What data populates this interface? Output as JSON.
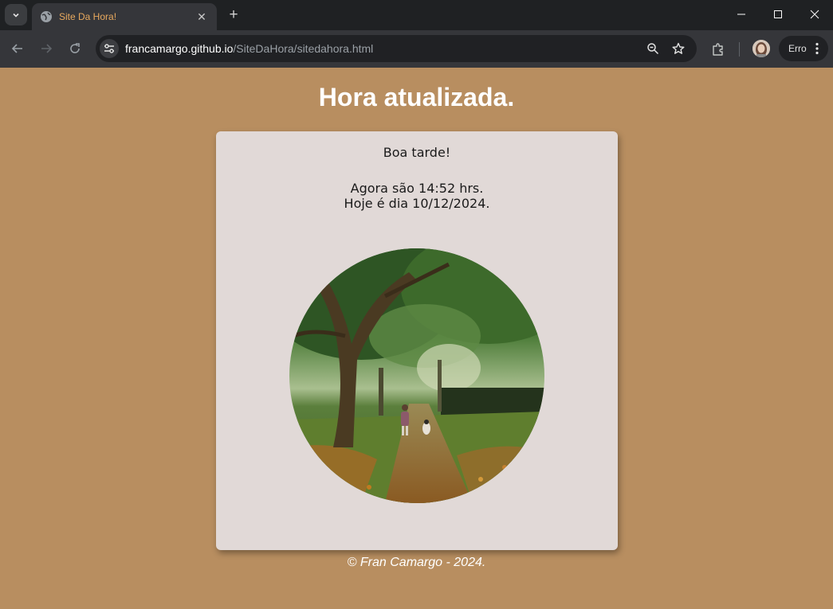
{
  "browser": {
    "tab_title": "Site Da Hora!",
    "url_host": "francamargo.github.io",
    "url_path": "/SiteDaHora/sitedahora.html",
    "profile_label": "Erro"
  },
  "page": {
    "title": "Hora atualizada.",
    "greeting": "Boa tarde!",
    "time_text": "Agora são 14:52 hrs.",
    "date_text": "Hoje é dia 10/12/2024.",
    "footer": "© Fran Camargo - 2024."
  },
  "colors": {
    "page_background": "#b88e60",
    "card_background": "#e1d9d7",
    "tab_title": "#e8a95e"
  },
  "icons": [
    "tab-search-icon",
    "globe-icon",
    "close-icon",
    "plus-icon",
    "minimize-icon",
    "maximize-icon",
    "window-close-icon",
    "back-icon",
    "forward-icon",
    "reload-icon",
    "site-info-icon",
    "zoom-icon",
    "star-icon",
    "extensions-icon",
    "avatar",
    "more-menu-icon"
  ]
}
